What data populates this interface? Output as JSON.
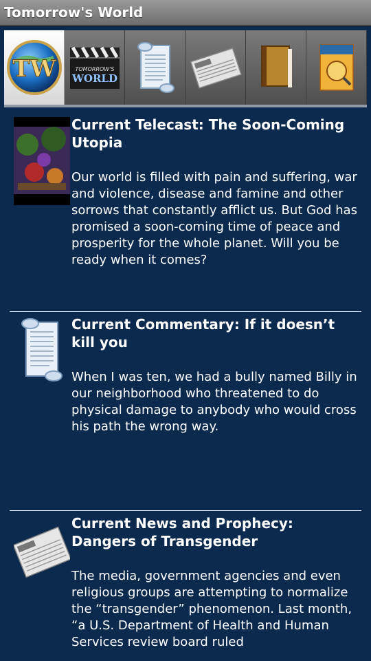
{
  "app": {
    "title": "Tomorrow's World"
  },
  "tabs": [
    {
      "name": "tw-logo",
      "selected": true
    },
    {
      "name": "telecast",
      "selected": false
    },
    {
      "name": "commentary",
      "selected": false
    },
    {
      "name": "news",
      "selected": false
    },
    {
      "name": "books",
      "selected": false
    },
    {
      "name": "magazine",
      "selected": false
    }
  ],
  "items": [
    {
      "icon": "telecast-thumbnail",
      "headline": "Current Telecast: The Soon-Coming Utopia",
      "summary": "Our world is filled with pain and suffering, war and violence, disease and famine and other sorrows that constantly afflict us. But God has promised a soon-coming time of peace and prosperity for the whole planet. Will you be ready when it comes?"
    },
    {
      "icon": "scroll-icon",
      "headline": "Current Commentary: If it doesn’t kill you",
      "summary": "When I was ten, we had a bully named Billy in our neighborhood who threatened to do physical damage to anybody who would cross his path the wrong way."
    },
    {
      "icon": "newspaper-icon",
      "headline": "Current News and Prophecy: Dangers of Transgender",
      "summary": "The media, government agencies and even religious groups are attempting to normalize the “transgender” phenomenon. Last month, “a U.S. Department of Health and Human Services review board ruled"
    }
  ]
}
